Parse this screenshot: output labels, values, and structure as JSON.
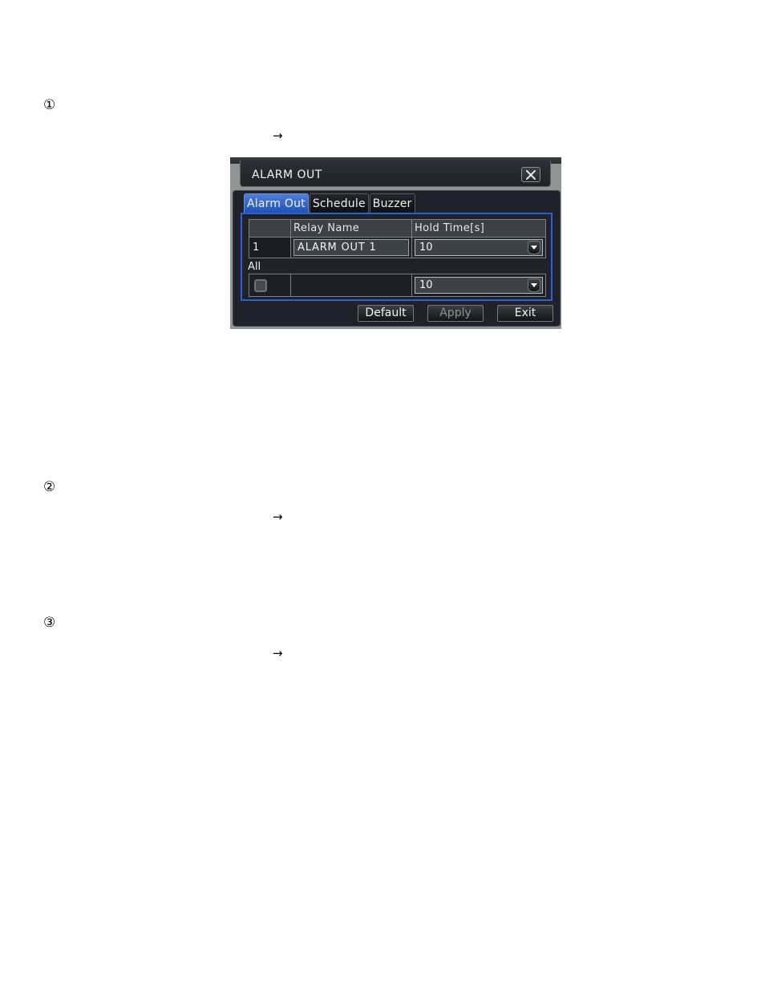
{
  "steps": [
    {
      "marker": "①",
      "arrow": "→"
    },
    {
      "marker": "②",
      "arrow": "→"
    },
    {
      "marker": "③",
      "arrow": "→"
    }
  ],
  "dialog": {
    "title": "ALARM OUT",
    "close_icon": "close-icon",
    "tabs": [
      {
        "label": "Alarm Out",
        "active": true
      },
      {
        "label": "Schedule",
        "active": false
      },
      {
        "label": "Buzzer",
        "active": false
      }
    ],
    "table": {
      "columns": [
        "",
        "Relay Name",
        "Hold Time[s]"
      ],
      "rows": [
        {
          "index": "1",
          "relay_name": "ALARM OUT 1",
          "hold_time": "10"
        }
      ]
    },
    "all": {
      "label": "All",
      "checked": false,
      "hold_time": "10"
    },
    "buttons": {
      "default": "Default",
      "apply": "Apply",
      "exit": "Exit"
    },
    "colors": {
      "accent": "#2c5fd0",
      "active_tab": "#3a6ac8",
      "background": "#20212a"
    }
  }
}
